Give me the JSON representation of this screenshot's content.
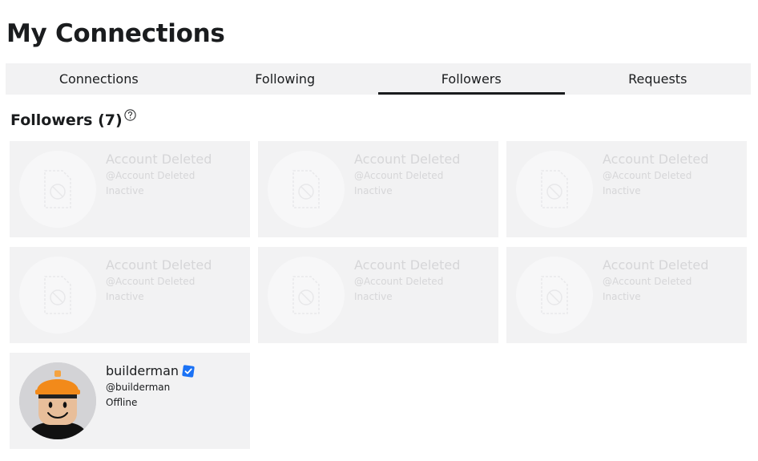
{
  "page_title": "My Connections",
  "tabs": [
    {
      "label": "Connections",
      "active": false
    },
    {
      "label": "Following",
      "active": false
    },
    {
      "label": "Followers",
      "active": true
    },
    {
      "label": "Requests",
      "active": false
    }
  ],
  "section": {
    "title": "Followers (7)",
    "help_icon": "question-circle-icon"
  },
  "followers": [
    {
      "name": "Account Deleted",
      "handle": "@Account Deleted",
      "status": "Inactive",
      "deleted": true,
      "avatar_icon": "broken-image-icon"
    },
    {
      "name": "Account Deleted",
      "handle": "@Account Deleted",
      "status": "Inactive",
      "deleted": true,
      "avatar_icon": "broken-image-icon"
    },
    {
      "name": "Account Deleted",
      "handle": "@Account Deleted",
      "status": "Inactive",
      "deleted": true,
      "avatar_icon": "broken-image-icon"
    },
    {
      "name": "Account Deleted",
      "handle": "@Account Deleted",
      "status": "Inactive",
      "deleted": true,
      "avatar_icon": "broken-image-icon"
    },
    {
      "name": "Account Deleted",
      "handle": "@Account Deleted",
      "status": "Inactive",
      "deleted": true,
      "avatar_icon": "broken-image-icon"
    },
    {
      "name": "Account Deleted",
      "handle": "@Account Deleted",
      "status": "Inactive",
      "deleted": true,
      "avatar_icon": "broken-image-icon"
    },
    {
      "name": "builderman",
      "handle": "@builderman",
      "status": "Offline",
      "deleted": false,
      "verified": true,
      "avatar_icon": "builderman-avatar"
    }
  ],
  "colors": {
    "card_bg": "#f2f2f3",
    "verified_blue": "#1b72f5",
    "text": "#1a1c1e",
    "deleted_text": "#d6d6d8"
  }
}
